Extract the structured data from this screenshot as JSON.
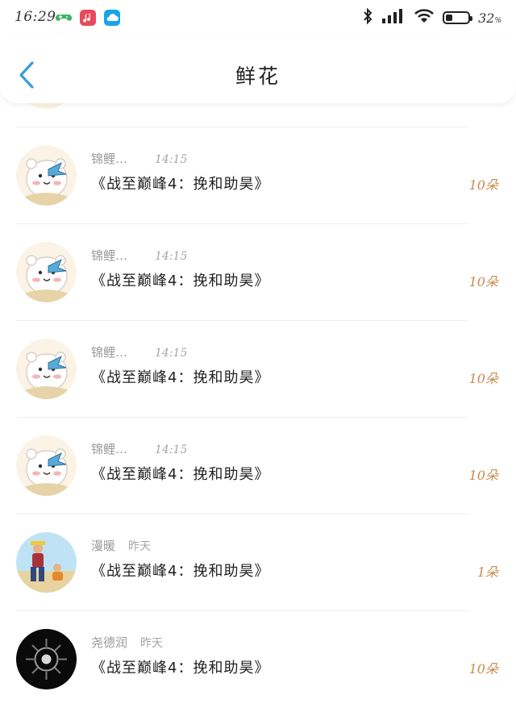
{
  "status_bar": {
    "time": "16:29",
    "battery_percent": "32",
    "battery_suffix": "%",
    "battery_level": 0.32,
    "icons": [
      "game-controller-icon",
      "music-app-icon",
      "cloud-app-icon",
      "bluetooth-icon",
      "signal-icon",
      "wifi-icon",
      "battery-icon"
    ]
  },
  "header": {
    "title": "鲜花",
    "back_icon": "chevron-left-icon",
    "accent_color": "#3a9bdc"
  },
  "rows": [
    {
      "name": "锦鲤…",
      "time": "14:15",
      "gift": "《战至巅峰4：挽和助昊》",
      "count": "10朵",
      "avatar": "hamster-avatar"
    },
    {
      "name": "锦鲤…",
      "time": "14:15",
      "gift": "《战至巅峰4：挽和助昊》",
      "count": "10朵",
      "avatar": "hamster-avatar"
    },
    {
      "name": "锦鲤…",
      "time": "14:15",
      "gift": "《战至巅峰4：挽和助昊》",
      "count": "10朵",
      "avatar": "hamster-avatar"
    },
    {
      "name": "锦鲤…",
      "time": "14:15",
      "gift": "《战至巅峰4：挽和助昊》",
      "count": "10朵",
      "avatar": "hamster-avatar"
    },
    {
      "name": "漫暖",
      "time": "昨天",
      "gift": "《战至巅峰4：挽和助昊》",
      "count": "1朵",
      "avatar": "photo-avatar"
    },
    {
      "name": "尧德润",
      "time": "昨天",
      "gift": "《战至巅峰4：挽和助昊》",
      "count": "10朵",
      "avatar": "dark-avatar"
    }
  ],
  "colors": {
    "count": "#c98a4a",
    "meta": "#9a9a9a"
  }
}
